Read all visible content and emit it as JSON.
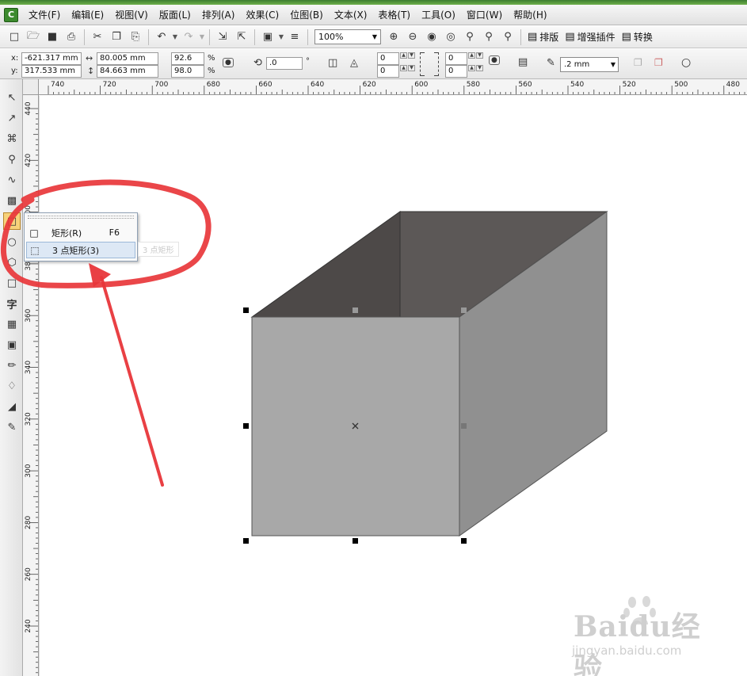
{
  "menu": [
    "文件(F)",
    "编辑(E)",
    "视图(V)",
    "版面(L)",
    "排列(A)",
    "效果(C)",
    "位图(B)",
    "文本(X)",
    "表格(T)",
    "工具(O)",
    "窗口(W)",
    "帮助(H)"
  ],
  "toolbar": {
    "zoom": "100%",
    "layout_label": "排版",
    "plugin_label": "增强插件",
    "convert_label": "转换"
  },
  "propbar": {
    "x_label": "x:",
    "x_value": "-621.317 mm",
    "y_label": "y:",
    "y_value": "317.533 mm",
    "width_value": "80.005 mm",
    "height_value": "84.663 mm",
    "scale_x": "92.6",
    "scale_y": "98.0",
    "percent": "%",
    "rotation": ".0",
    "degree": "°",
    "corner_tl": "0",
    "corner_bl": "0",
    "corner_tr": "0",
    "corner_br": "0",
    "outline_width": ".2 mm"
  },
  "ruler": {
    "h_labels": [
      "740",
      "720",
      "700",
      "680",
      "660",
      "640",
      "620",
      "600",
      "580",
      "560",
      "540",
      "520",
      "500",
      "480"
    ],
    "v_labels": [
      "440",
      "420",
      "400",
      "380",
      "360",
      "340",
      "320",
      "300",
      "280",
      "260",
      "240"
    ]
  },
  "flyout": {
    "items": [
      {
        "label": "矩形(R)",
        "shortcut": "F6"
      },
      {
        "label": "3 点矩形(3)",
        "shortcut": ""
      }
    ],
    "ghost_tip": "3 点矩形"
  },
  "watermark": {
    "main": "Baidu经验",
    "sub": "jingyan.baidu.com"
  },
  "colors": {
    "box_front": "#a8a8a8",
    "box_side": "#909090",
    "box_inner_left": "#4d4948",
    "box_inner_back": "#5c5857",
    "annotation": "#e8363a"
  },
  "icons": {
    "tools": [
      "pick-icon",
      "shape-icon",
      "crop-icon",
      "zoom-icon",
      "freehand-icon",
      "smart-fill-icon",
      "rectangle-icon",
      "ellipse-icon",
      "polygon-icon",
      "basic-shapes-icon",
      "text-icon",
      "table-icon",
      "interactive-effects-icon",
      "eyedropper-icon",
      "outline-pen-icon",
      "fill-icon",
      "interactive-fill-icon"
    ]
  }
}
